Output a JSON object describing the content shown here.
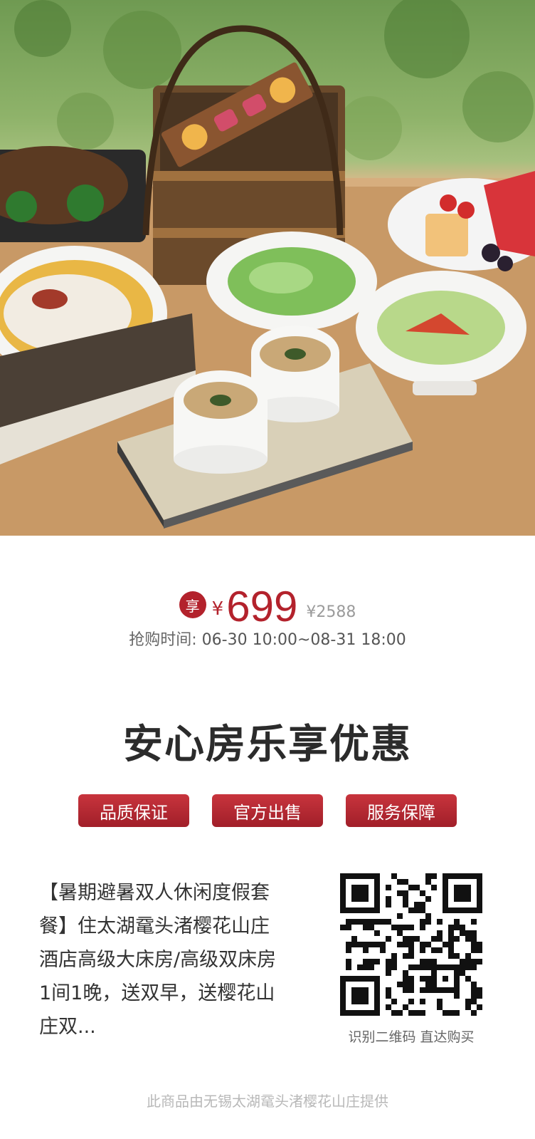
{
  "price": {
    "badge": "享",
    "currency": "¥",
    "current": "699",
    "original": "¥2588",
    "sale_time_label": "抢购时间:",
    "sale_time_value": "06-30 10:00~08-31 18:00"
  },
  "headline": "安心房乐享优惠",
  "tags": [
    "品质保证",
    "官方出售",
    "服务保障"
  ],
  "description": "【暑期避暑双人休闲度假套餐】住太湖鼋头渚樱花山庄酒店高级大床房/高级双床房1间1晚，送双早，送樱花山庄双...",
  "qr_caption": "识别二维码 直达购买",
  "footer": "此商品由无锡太湖鼋头渚樱花山庄提供",
  "colors": {
    "accent": "#b3222c",
    "text": "#333333",
    "muted": "#9b9b9b"
  },
  "icons": {
    "badge": "enjoy-badge-icon",
    "qr": "qr-code-icon"
  }
}
